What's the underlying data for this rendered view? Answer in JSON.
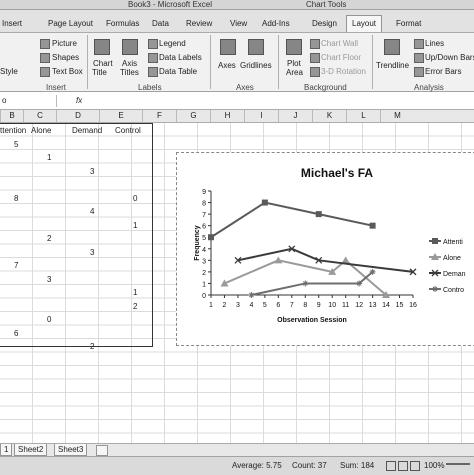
{
  "app": {
    "title": "Book3 - Microsoft Excel",
    "context_title": "Chart Tools"
  },
  "tabs": [
    "Insert",
    "Page Layout",
    "Formulas",
    "Data",
    "Review",
    "View",
    "Add-Ins",
    "Design",
    "Layout",
    "Format"
  ],
  "active_tab": "Layout",
  "ribbon": {
    "insert_group": {
      "picture": "Picture",
      "shapes": "Shapes",
      "textbox": "Text Box",
      "style_fragment": "Style",
      "label": "Insert"
    },
    "labels_group": {
      "chart_title": [
        "Chart",
        "Title"
      ],
      "axis_titles": [
        "Axis",
        "Titles"
      ],
      "legend": "Legend",
      "data_labels": "Data Labels",
      "data_table": "Data Table",
      "label": "Labels"
    },
    "axes_group": {
      "axes": "Axes",
      "gridlines": "Gridlines",
      "label": "Axes"
    },
    "background_group": {
      "plot_area": [
        "Plot",
        "Area"
      ],
      "chart_wall": "Chart Wall",
      "chart_floor": "Chart Floor",
      "rotation": "3-D Rotation",
      "label": "Background"
    },
    "analysis_group": {
      "trendline": "Trendline",
      "lines": "Lines",
      "updown_bars": "Up/Down Bars",
      "error_bars": "Error Bars",
      "label": "Analysis"
    }
  },
  "formula_bar": {
    "name_box_fragment": "o",
    "fx": "fx",
    "value": ""
  },
  "columns": [
    "B",
    "C",
    "D",
    "E",
    "F",
    "G",
    "H",
    "I",
    "J",
    "K",
    "L",
    "M"
  ],
  "headers_row": {
    "b": "ttention",
    "c": "Alone",
    "d": "Demand",
    "e": "Control"
  },
  "cell_values": [
    {
      "col": "B",
      "row": 1,
      "v": "5"
    },
    {
      "col": "C",
      "row": 2,
      "v": "1"
    },
    {
      "col": "D",
      "row": 3,
      "v": "3"
    },
    {
      "col": "B",
      "row": 5,
      "v": "8"
    },
    {
      "col": "E",
      "row": 5,
      "v": "0"
    },
    {
      "col": "D",
      "row": 6,
      "v": "4"
    },
    {
      "col": "E",
      "row": 7,
      "v": "1"
    },
    {
      "col": "C",
      "row": 8,
      "v": "2"
    },
    {
      "col": "D",
      "row": 9,
      "v": "3"
    },
    {
      "col": "B",
      "row": 10,
      "v": "7"
    },
    {
      "col": "C",
      "row": 11,
      "v": "3"
    },
    {
      "col": "E",
      "row": 12,
      "v": "1"
    },
    {
      "col": "E",
      "row": 13,
      "v": "2"
    },
    {
      "col": "C",
      "row": 14,
      "v": "0"
    },
    {
      "col": "B",
      "row": 15,
      "v": "6"
    },
    {
      "col": "D",
      "row": 16,
      "v": "2"
    }
  ],
  "chart_data": {
    "type": "line",
    "title": "Michael's FA",
    "xlabel": "Observation Session",
    "ylabel": "Frequency",
    "x_ticks": [
      1,
      2,
      3,
      4,
      5,
      6,
      7,
      8,
      9,
      10,
      11,
      12,
      13,
      14,
      15,
      16
    ],
    "y_ticks": [
      0,
      1,
      2,
      3,
      4,
      5,
      6,
      7,
      8,
      9
    ],
    "ylim": [
      0,
      9
    ],
    "xlim": [
      1,
      16
    ],
    "legend_position": "right",
    "series": [
      {
        "name": "Attention",
        "marker": "square",
        "color": "#5a5a5a",
        "points": [
          [
            1,
            5
          ],
          [
            5,
            8
          ],
          [
            9,
            7
          ],
          [
            13,
            6
          ]
        ]
      },
      {
        "name": "Alone",
        "marker": "triangle",
        "color": "#9a9a9a",
        "points": [
          [
            2,
            1
          ],
          [
            6,
            3
          ],
          [
            10,
            2
          ],
          [
            11,
            3
          ],
          [
            14,
            0
          ]
        ]
      },
      {
        "name": "Demand",
        "marker": "x",
        "color": "#3a3a3a",
        "points": [
          [
            3,
            3
          ],
          [
            7,
            4
          ],
          [
            9,
            3
          ],
          [
            16,
            2
          ]
        ]
      },
      {
        "name": "Control",
        "marker": "star",
        "color": "#6e6e6e",
        "points": [
          [
            4,
            0
          ],
          [
            8,
            1
          ],
          [
            12,
            1
          ],
          [
            13,
            2
          ]
        ]
      }
    ],
    "legend_labels": [
      "Attenti",
      "Alone",
      "Deman",
      "Contro"
    ]
  },
  "sheet_tabs": [
    "1",
    "Sheet2",
    "Sheet3"
  ],
  "status": {
    "average": "Average: 5.75",
    "count": "Count: 37",
    "sum": "Sum: 184",
    "zoom": "100%"
  }
}
